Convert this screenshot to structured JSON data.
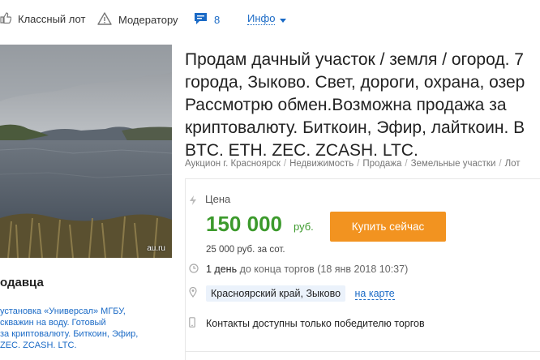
{
  "toolbar": {
    "classic_lot": {
      "label": "Классный лот",
      "icon": "thumb-icon"
    },
    "moderator": {
      "label": "Модератору",
      "icon": "warning-icon"
    },
    "comments": {
      "count": "8",
      "icon": "comment-icon"
    },
    "info": {
      "label": "Инфо",
      "icon": "chevron-down-icon"
    }
  },
  "photo": {
    "watermark": "au.ru"
  },
  "lot": {
    "title_lines": [
      "Продам дачный участок / земля / огород. 7",
      "города, Зыково. Свет, дороги, охрана, озер",
      "Рассмотрю обмен.Возможна продажа за",
      "криптовалюту. Биткоин, Эфир, лайткоин. В",
      "BTC. ETH. ZEC. ZCASH. LTC."
    ],
    "breadcrumb": [
      "Аукцион г. Красноярск",
      "Недвижимость",
      "Продажа",
      "Земельные участки",
      "Лот"
    ]
  },
  "price": {
    "label": "Цена",
    "value": "150 000",
    "currency": "руб.",
    "per_unit": "25 000 руб. за сот.",
    "buy_label": "Купить сейчас"
  },
  "auction": {
    "time_left_bold": "1 день",
    "time_left_rest": "до конца торгов",
    "end_date": "(18 янв 2018 10:37)",
    "location": "Красноярский край, Зыково",
    "map_link": "на карте",
    "contacts": "Контакты доступны только победителю торгов"
  },
  "seller": {
    "title": "одавца",
    "desc_lines": [
      "установка «Универсал» МГБУ,",
      "скважин на воду. Готовый",
      "за криптовалюту. Биткоин, Эфир,",
      "ZEC. ZCASH. LTC."
    ]
  },
  "colors": {
    "accent": "#1a6ac6",
    "price": "#3c9a2c",
    "buy_button": "#f29320"
  }
}
